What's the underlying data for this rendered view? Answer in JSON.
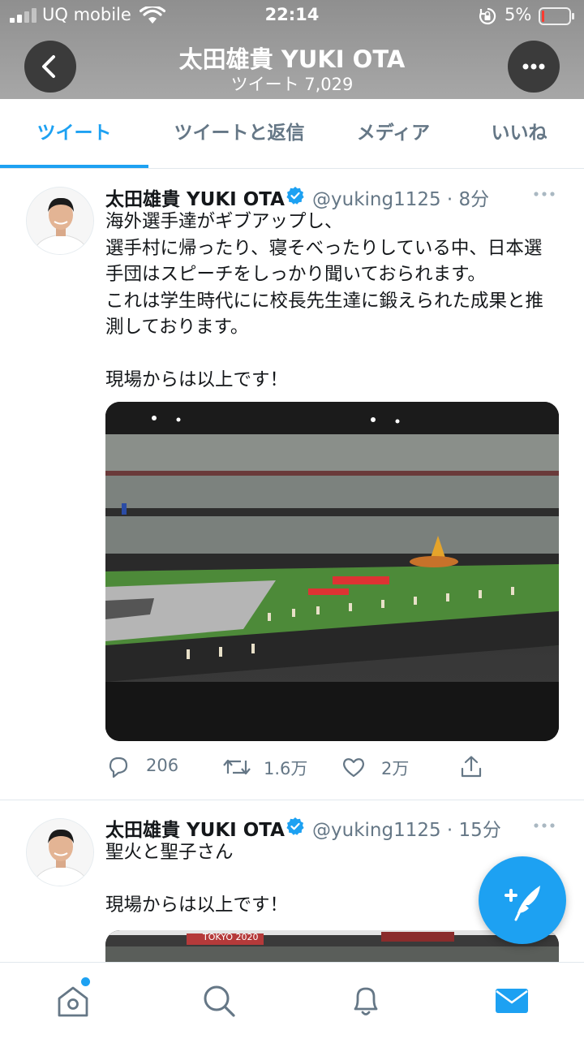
{
  "status_bar": {
    "carrier": "UQ mobile",
    "time": "22:14",
    "battery": "5%"
  },
  "profile_header": {
    "name": "太田雄貴 YUKI OTA",
    "tweet_count": "ツイート 7,029"
  },
  "tabs": [
    {
      "label": "ツイート",
      "active": true
    },
    {
      "label": "ツイートと返信",
      "active": false
    },
    {
      "label": "メディア",
      "active": false
    },
    {
      "label": "いいね",
      "active": false
    }
  ],
  "tweets": [
    {
      "name": "太田雄貴 YUKI OTA",
      "handle": "@yuking1125",
      "time": "8分",
      "text": "海外選手達がギブアップし、\n選手村に帰ったり、寝そべったりしている中、日本選手団はスピーチをしっかり聞いておられます。\nこれは学生時代にに校長先生達に鍛えられた成果と推測しております。\n\n現場からは以上です！",
      "replies": "206",
      "retweets": "1.6万",
      "likes": "2万"
    },
    {
      "name": "太田雄貴 YUKI OTA",
      "handle": "@yuking1125",
      "time": "15分",
      "text": "聖火と聖子さん\n\n現場からは以上です！",
      "media_sign": "TOKYO 2020"
    }
  ],
  "colors": {
    "accent": "#1da1f2",
    "text": "#14171a",
    "secondary": "#657786"
  },
  "icons": {
    "back": "chevron-left-icon",
    "more": "more-horizontal-icon",
    "reply": "comment-icon",
    "retweet": "retweet-icon",
    "like": "heart-icon",
    "share": "share-icon",
    "compose": "compose-tweet-icon",
    "nav": [
      "home-icon",
      "search-icon",
      "notifications-icon",
      "messages-icon"
    ]
  }
}
